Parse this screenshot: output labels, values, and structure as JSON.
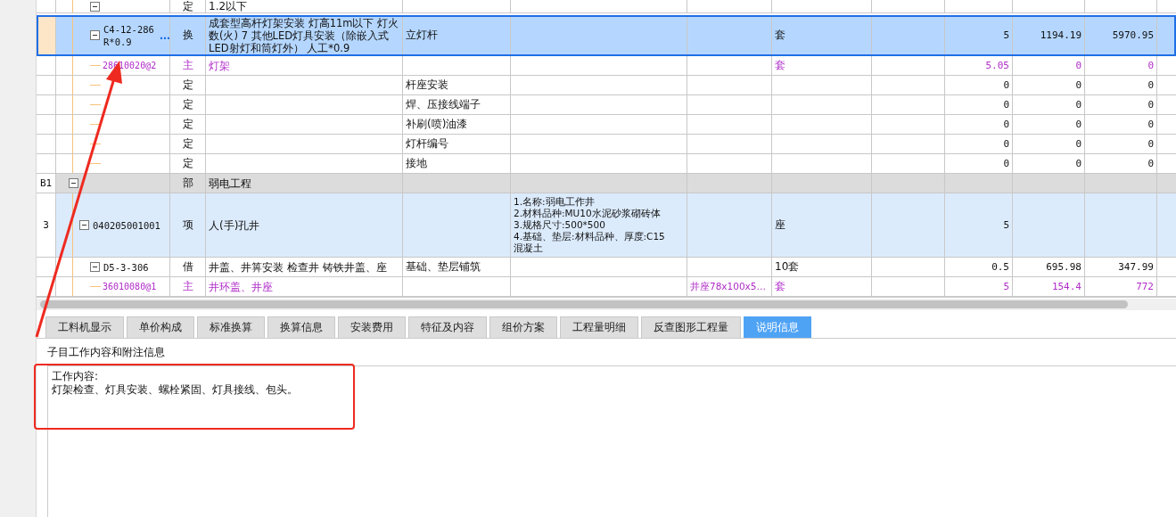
{
  "table": {
    "rows": [
      {
        "kind": "quota",
        "type": "定",
        "name": "1.2以下",
        "selected": false,
        "expanded": true
      },
      {
        "kind": "quota",
        "code": "C4-12-286\nR*0.9",
        "more": "…",
        "type": "换",
        "name": "成套型高杆灯架安装 灯高11m以下 灯火数(火) 7  其他LED灯具安装（除嵌入式LED射灯和筒灯外） 人工*0.9",
        "col4": "立灯杆",
        "unit": "套",
        "qty": "5",
        "price": "1194.19",
        "total": "5970.95",
        "selected": true,
        "expanded": true,
        "children": [
          {
            "kind": "resource",
            "code": "28610020@2",
            "type": "主",
            "name": "灯架",
            "unit": "套",
            "qty": "5.05",
            "price": "0",
            "total": "0",
            "selected": false
          },
          {
            "kind": "plain",
            "type": "定",
            "col4": "杆座安装",
            "qty": "0",
            "price": "0",
            "total": "0",
            "selected": false
          },
          {
            "kind": "plain",
            "type": "定",
            "col4": "焊、压接线端子",
            "qty": "0",
            "price": "0",
            "total": "0",
            "selected": false
          },
          {
            "kind": "plain",
            "type": "定",
            "col4": "补刷(喷)油漆",
            "qty": "0",
            "price": "0",
            "total": "0",
            "selected": false
          },
          {
            "kind": "plain",
            "type": "定",
            "col4": "灯杆编号",
            "qty": "0",
            "price": "0",
            "total": "0",
            "selected": false
          },
          {
            "kind": "plain",
            "type": "定",
            "col4": "接地",
            "qty": "0",
            "price": "0",
            "total": "0",
            "selected": false
          }
        ]
      },
      {
        "kind": "section",
        "number": "B1",
        "type": "部",
        "name": "弱电工程",
        "selected": false,
        "expanded": true,
        "children": [
          {
            "kind": "item",
            "number": "3",
            "code": "040205001001",
            "type": "项",
            "name": "人(手)孔井",
            "features": "1.名称:弱电工作井\n2.材料品种:MU10水泥砂浆砌砖体\n3.规格尺寸:500*500\n4.基础、垫层:材料品种、厚度:C15\n混凝土",
            "unit": "座",
            "qty": "5",
            "selected": false,
            "expanded": true,
            "children": [
              {
                "kind": "quota",
                "code": "D5-3-306",
                "type": "借",
                "name": "井盖、井箅安装 检查井 铸铁井盖、座",
                "col4": "基础、垫层铺筑",
                "unit": "10套",
                "qty": "0.5",
                "price": "695.98",
                "total": "347.99",
                "selected": false,
                "expanded": true,
                "children": [
                  {
                    "kind": "resource",
                    "code": "36010080@1",
                    "type": "主",
                    "name": "井环盖、井座",
                    "col6": "井座78x100x5…",
                    "unit": "套",
                    "qty": "5",
                    "price": "154.4",
                    "total": "772",
                    "selected": false
                  }
                ]
              }
            ]
          }
        ]
      }
    ]
  },
  "tabs": [
    {
      "label": "工料机显示",
      "selected": false
    },
    {
      "label": "单价构成",
      "selected": false
    },
    {
      "label": "标准换算",
      "selected": false
    },
    {
      "label": "换算信息",
      "selected": false
    },
    {
      "label": "安装费用",
      "selected": false
    },
    {
      "label": "特征及内容",
      "selected": false
    },
    {
      "label": "组价方案",
      "selected": false
    },
    {
      "label": "工程量明细",
      "selected": false
    },
    {
      "label": "反查图形工程量",
      "selected": false
    },
    {
      "label": "说明信息",
      "selected": true
    }
  ],
  "panel": {
    "title": "子目工作内容和附注信息",
    "lines": [
      "工作内容:",
      "灯架检查、灯具安装、螺栓紧固、灯具接线、包头。"
    ]
  },
  "annotations": {
    "arrow": true,
    "highlight_box": true
  }
}
